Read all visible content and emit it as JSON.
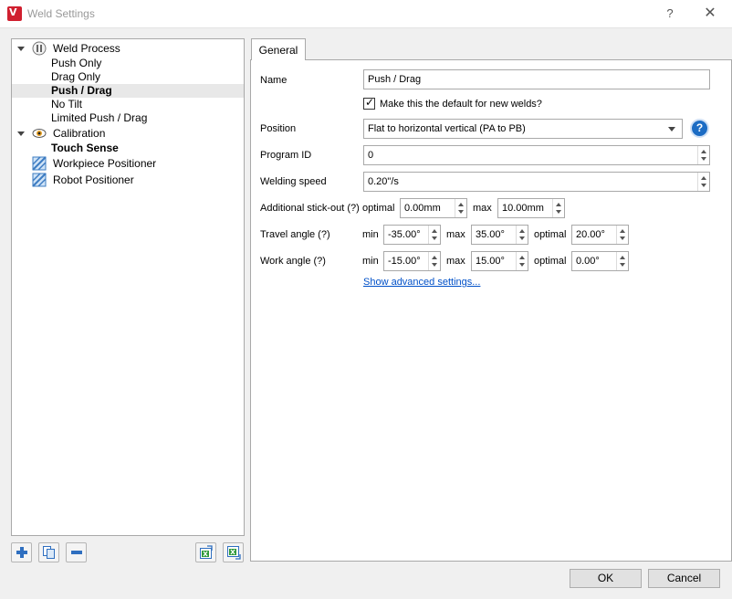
{
  "window": {
    "title": "Weld Settings",
    "help": "?",
    "close": "✕"
  },
  "tree": {
    "items": [
      {
        "label": "Weld Process",
        "bold": false
      },
      {
        "label": "Push Only",
        "bold": false
      },
      {
        "label": "Drag Only",
        "bold": false
      },
      {
        "label": "Push / Drag",
        "bold": true
      },
      {
        "label": "No Tilt",
        "bold": false
      },
      {
        "label": "Limited Push / Drag",
        "bold": false
      },
      {
        "label": "Calibration",
        "bold": false
      },
      {
        "label": "Touch Sense",
        "bold": true
      },
      {
        "label": "Workpiece Positioner",
        "bold": false
      },
      {
        "label": "Robot Positioner",
        "bold": false
      }
    ]
  },
  "tabs": {
    "general": "General"
  },
  "form": {
    "name_label": "Name",
    "name_value": "Push / Drag",
    "default_check_label": "Make this the default for new welds?",
    "default_checked": true,
    "position_label": "Position",
    "position_value": "Flat to horizontal vertical (PA to PB)",
    "program_id_label": "Program ID",
    "program_id_value": "0",
    "speed_label": "Welding speed",
    "speed_value": "0.20\"/s",
    "stickout_label": "Additional stick-out (?)",
    "stickout_optimal_label": "optimal",
    "stickout_optimal": "0.00mm",
    "stickout_max_label": "max",
    "stickout_max": "10.00mm",
    "travel_label": "Travel angle (?)",
    "travel_min_label": "min",
    "travel_min": "-35.00°",
    "travel_max_label": "max",
    "travel_max": "35.00°",
    "travel_opt_label": "optimal",
    "travel_opt": "20.00°",
    "work_label": "Work angle (?)",
    "work_min_label": "min",
    "work_min": "-15.00°",
    "work_max_label": "max",
    "work_max": "15.00°",
    "work_opt_label": "optimal",
    "work_opt": "0.00°",
    "advanced_link": "Show advanced settings...",
    "help_glyph": "?"
  },
  "buttons": {
    "ok": "OK",
    "cancel": "Cancel"
  },
  "colors": {
    "selection": "#e8e8e8",
    "link": "#0050c8",
    "help": "#1c6cc4",
    "brand": "#d01f2f"
  }
}
